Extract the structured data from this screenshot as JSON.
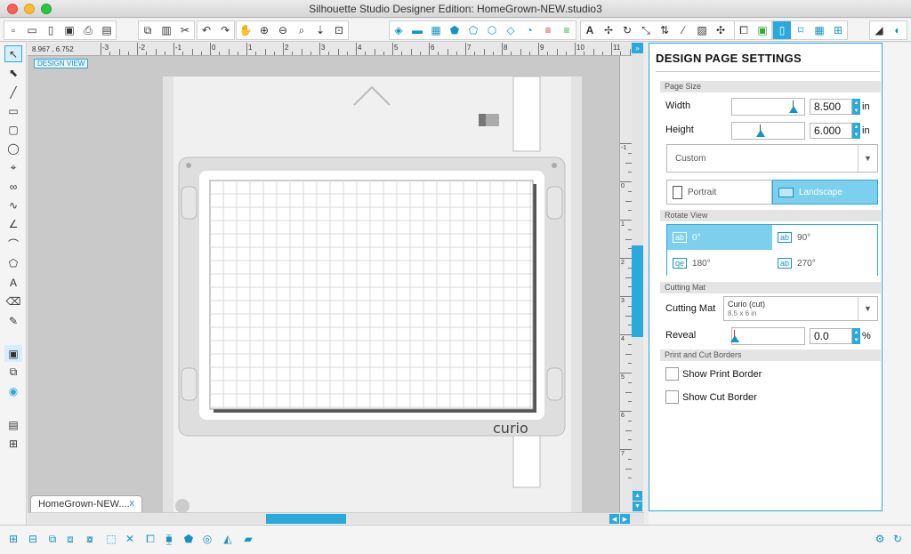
{
  "window": {
    "title": "Silhouette Studio Designer Edition: HomeGrown-NEW.studio3"
  },
  "toolbar": {
    "file_icons": [
      "new-file-icon",
      "open-file-icon",
      "save-sd-icon",
      "save-icon",
      "print-icon",
      "send-cut-icon"
    ],
    "edit_icons": [
      "copy-icon",
      "paste-icon",
      "cut-icon"
    ],
    "history_icons": [
      "undo-icon",
      "redo-icon"
    ],
    "view_icons": [
      "pan-icon",
      "zoom-in-icon",
      "zoom-out-icon",
      "zoom-select-icon",
      "zoom-drag-icon",
      "fit-page-icon"
    ],
    "panel_icons": [
      "fill-icon",
      "gradient-icon",
      "pattern-icon",
      "shape-icon",
      "offset-icon",
      "trace-icon",
      "transform-icon",
      "knife-icon",
      "line-style-icon",
      "text-icon",
      "replicate-icon",
      "rotate-icon",
      "scale-icon",
      "modify-icon",
      "warp-icon",
      "library-icon",
      "store-icon",
      "page-settings-icon",
      "cut-settings-icon",
      "grid-icon",
      "registration-icon",
      "eraser-icon",
      "send-icon"
    ]
  },
  "canvas": {
    "coords": "8.967 , 6.752",
    "design_view_label": "DESIGN VIEW",
    "ruler_labels": [
      "-3",
      "-2",
      "-1",
      "0",
      "1",
      "2",
      "3",
      "4",
      "5",
      "6",
      "7",
      "8",
      "9",
      "10",
      "11"
    ],
    "vruler_labels": [
      "-1",
      "0",
      "1",
      "2",
      "3",
      "4",
      "5",
      "6",
      "7"
    ],
    "mat_brand": "curio",
    "tab_label": "HomeGrown-NEW....",
    "tab_close": "x"
  },
  "panel": {
    "title": "DESIGN PAGE SETTINGS",
    "page_size": {
      "section": "Page Size",
      "width_label": "Width",
      "width_value": "8.500",
      "height_label": "Height",
      "height_value": "6.000",
      "unit": "in",
      "preset": "Custom",
      "portrait": "Portrait",
      "landscape": "Landscape"
    },
    "rotate": {
      "section": "Rotate View",
      "r0": "0°",
      "r90": "90°",
      "r180": "180°",
      "r270": "270°"
    },
    "cutting_mat": {
      "section": "Cutting Mat",
      "label": "Cutting Mat",
      "value": "Curio (cut)",
      "size": "8.5 x 6 in",
      "reveal_label": "Reveal",
      "reveal_value": "0.0",
      "reveal_unit": "%"
    },
    "borders": {
      "section": "Print and Cut Borders",
      "print": "Show Print Border",
      "cut": "Show Cut Border"
    }
  },
  "colors": {
    "accent": "#29a9dc",
    "accent_dark": "#1693c1"
  }
}
